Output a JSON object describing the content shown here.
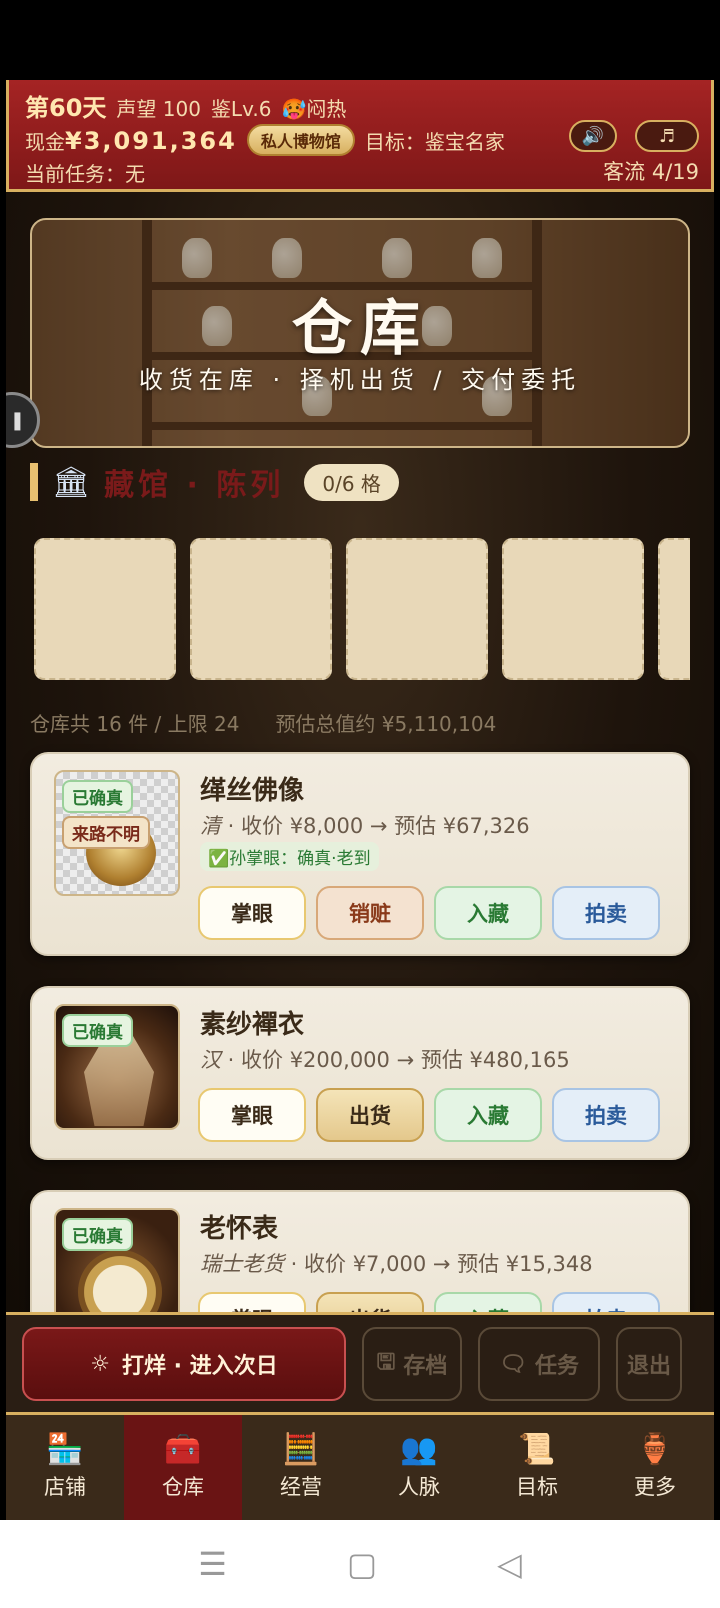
{
  "header": {
    "day": "第60天",
    "reputation": "声望 100",
    "appraisal_level": "鉴Lv.6",
    "weather_icon": "hot-face-emoji",
    "weather_glyph": "🥵",
    "weather": "闷热",
    "cash_label": "现金",
    "cash_value": "¥3,091,364",
    "museum_badge": "私人博物馆",
    "goal": "目标：鉴宝名家",
    "task": "当前任务：无",
    "visitors": "客流 4/19",
    "sound_glyph": "🔊",
    "music_glyph": "♬"
  },
  "banner": {
    "title": "仓库",
    "subtitle": "收货在库 · 择机出货 / 交付委托"
  },
  "collection": {
    "icon": "museum-icon",
    "icon_glyph": "🏛",
    "title": "藏馆 · 陈列",
    "slots_badge": "0/6 格"
  },
  "storage": {
    "total_text": "仓库共 16 件 / 上限 24",
    "value_text": "预估总值约 ¥5,110,104"
  },
  "items": [
    {
      "name": "缂丝佛像",
      "era": "清",
      "price_text": " · 收价 ¥8,000 → 预估 ¥67,326",
      "tag1": "已确真",
      "tag2": "来路不明",
      "appraisal": "✅孙掌眼：确真·老到",
      "btn1": "掌眼",
      "btn2": "销赃",
      "btn3": "入藏",
      "btn4": "拍卖"
    },
    {
      "name": "素纱襌衣",
      "era": "汉",
      "price_text": " · 收价 ¥200,000 → 预估 ¥480,165",
      "tag1": "已确真",
      "btn1": "掌眼",
      "btn2": "出货",
      "btn3": "入藏",
      "btn4": "拍卖"
    },
    {
      "name": "老怀表",
      "era": "瑞士老货",
      "price_text": " · 收价 ¥7,000 → 预估 ¥15,348",
      "tag1": "已确真",
      "btn1": "掌眼",
      "btn2": "出货",
      "btn3": "入藏",
      "btn4": "拍卖"
    }
  ],
  "actions": {
    "next_day_glyph": "☼",
    "next_day": "打烊 · 进入次日",
    "save_glyph": "🖫",
    "save": "存档",
    "task_glyph": "🗨",
    "task": "任务",
    "exit": "退出"
  },
  "nav": [
    {
      "label": "店铺",
      "icon": "shop-icon",
      "glyph": "🏪"
    },
    {
      "label": "仓库",
      "icon": "warehouse-chest-icon",
      "glyph": "🧰"
    },
    {
      "label": "经营",
      "icon": "abacus-icon",
      "glyph": "🧮"
    },
    {
      "label": "人脉",
      "icon": "people-icon",
      "glyph": "👥"
    },
    {
      "label": "目标",
      "icon": "scroll-icon",
      "glyph": "📜"
    },
    {
      "label": "更多",
      "icon": "more-vase-icon",
      "glyph": "🏺"
    }
  ],
  "nav_active": "仓库",
  "system_nav": {
    "menu": "☰",
    "home": "▢",
    "back": "◁"
  },
  "colors": {
    "header_red": "#9a2020",
    "gold": "#d8b060",
    "active_nav": "#6a1414",
    "confirmed_green": "#2a7a34",
    "auction_blue": "#2a5a9a"
  }
}
